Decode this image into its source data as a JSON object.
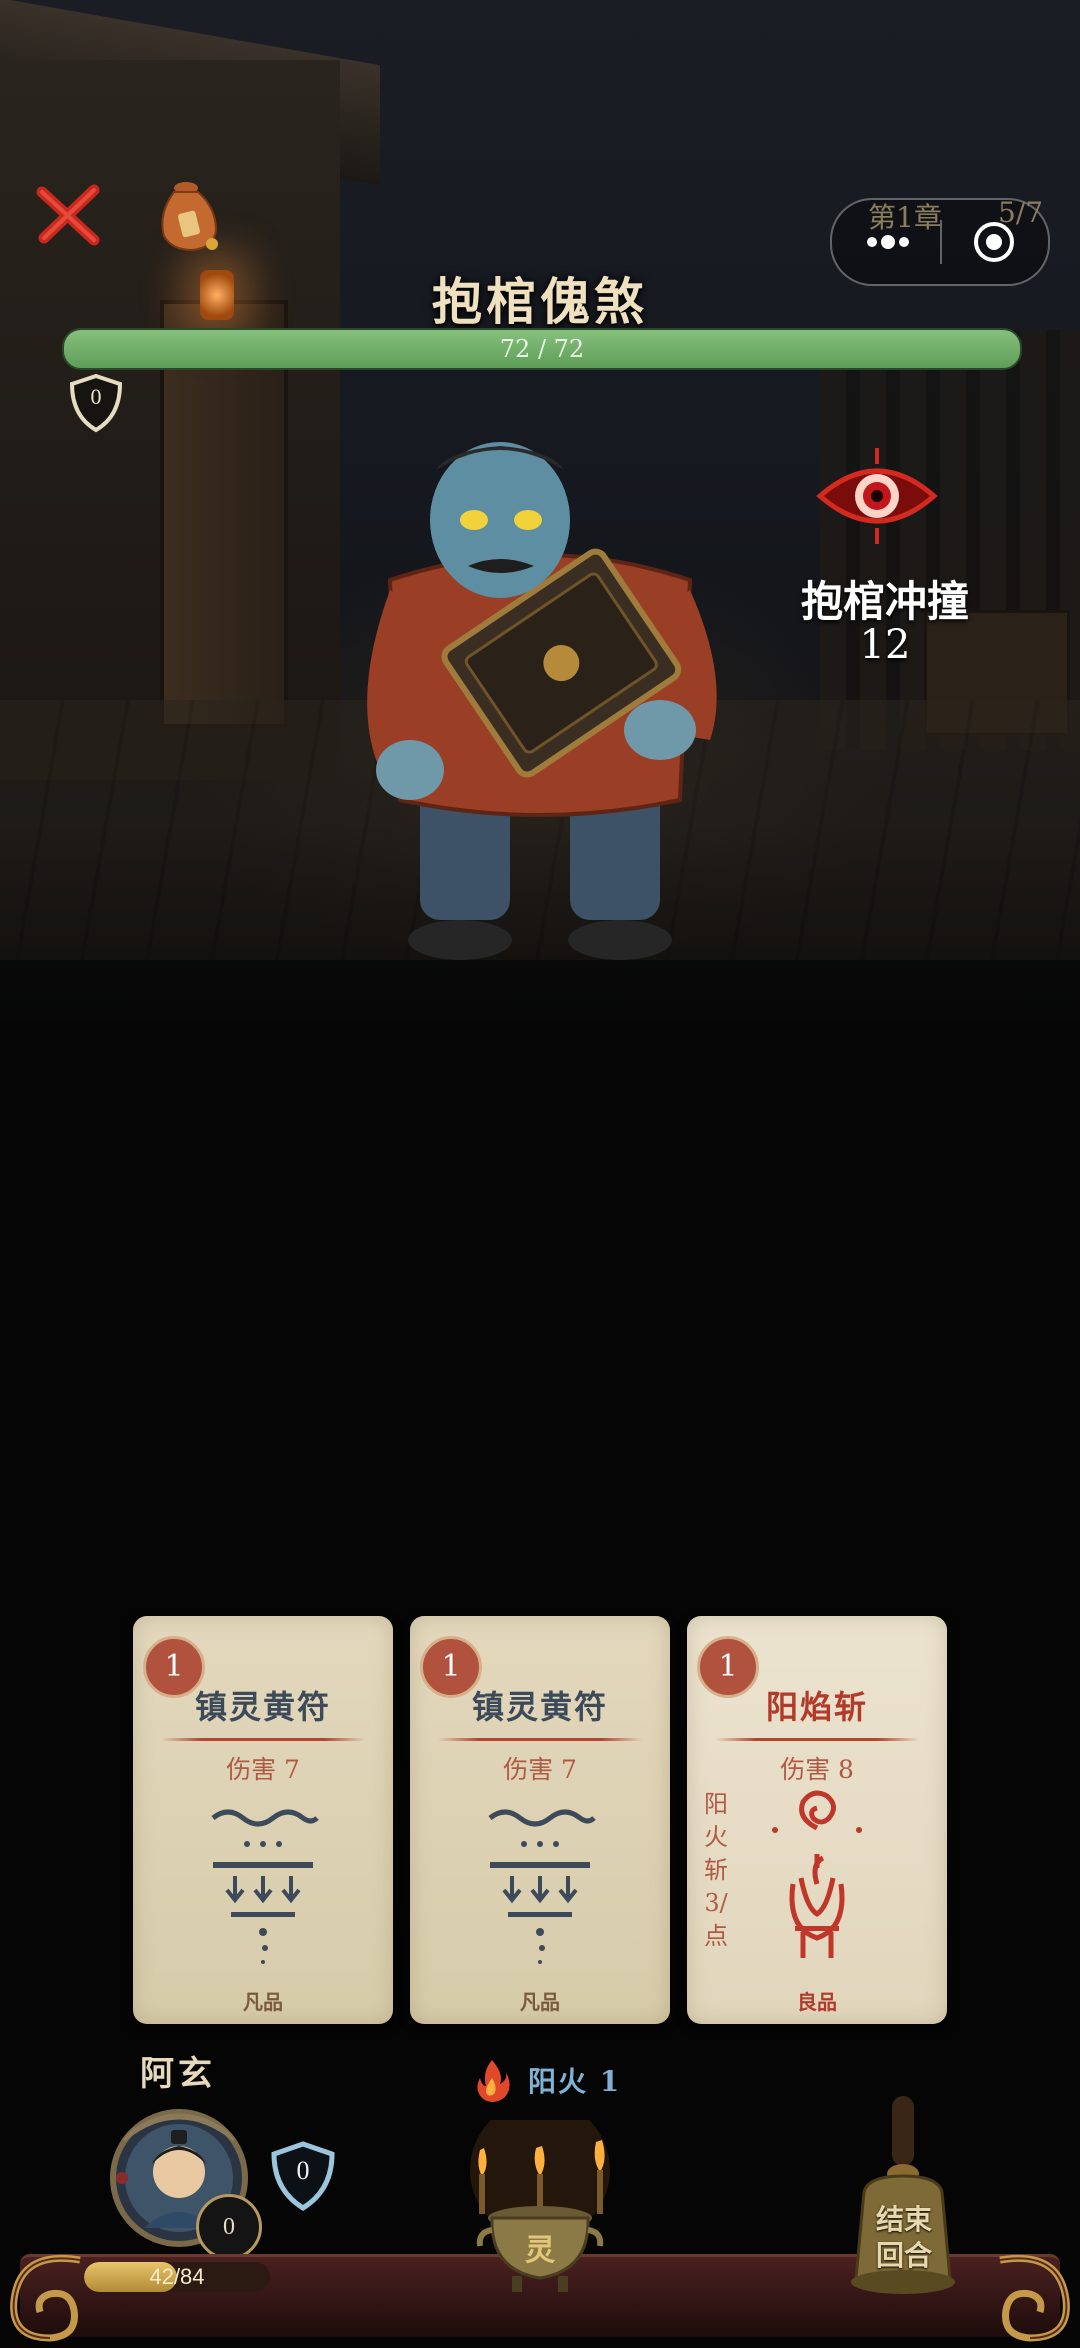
{
  "header": {
    "chapter": "第1章",
    "progress": "5/7"
  },
  "enemy": {
    "name": "抱棺傀煞",
    "hp_text": "72 / 72",
    "hp_fraction": 1.0,
    "block": "0",
    "intent": {
      "name": "抱棺冲撞",
      "value": "12"
    }
  },
  "hand": [
    {
      "cost": "1",
      "title": "镇灵黄符",
      "desc": "伤害 7",
      "rarity": "凡品"
    },
    {
      "cost": "1",
      "title": "镇灵黄符",
      "desc": "伤害 7",
      "rarity": "凡品"
    },
    {
      "cost": "1",
      "title": "阳焰斩",
      "desc": "伤害 8",
      "side_text": "阳火斩3/点",
      "rarity": "良品"
    }
  ],
  "player": {
    "name": "阿玄",
    "block": "0",
    "shield": "0",
    "hp_text_left": "42",
    "hp_text_right": "/84",
    "hp_fraction": 0.5
  },
  "energy": {
    "label": "阳火 1",
    "incense_glyph": "灵"
  },
  "end_turn": {
    "label_line1": "结束",
    "label_line2": "回合"
  },
  "colors": {
    "enemy_hp": "#7cb874",
    "player_hp": "#d9b85c",
    "card_cost": "#b0523e",
    "rare_title": "#b23a2a",
    "energy_label": "#7fb2d4"
  },
  "icons": {
    "close": "close-icon",
    "bag": "coin-bag-icon",
    "menu": "more-dots-icon",
    "capsule_close": "target-icon",
    "intent": "evil-eye-icon",
    "fire": "fire-icon",
    "shield": "shield-icon",
    "bell": "bell-icon",
    "incense": "incense-burner-icon"
  }
}
